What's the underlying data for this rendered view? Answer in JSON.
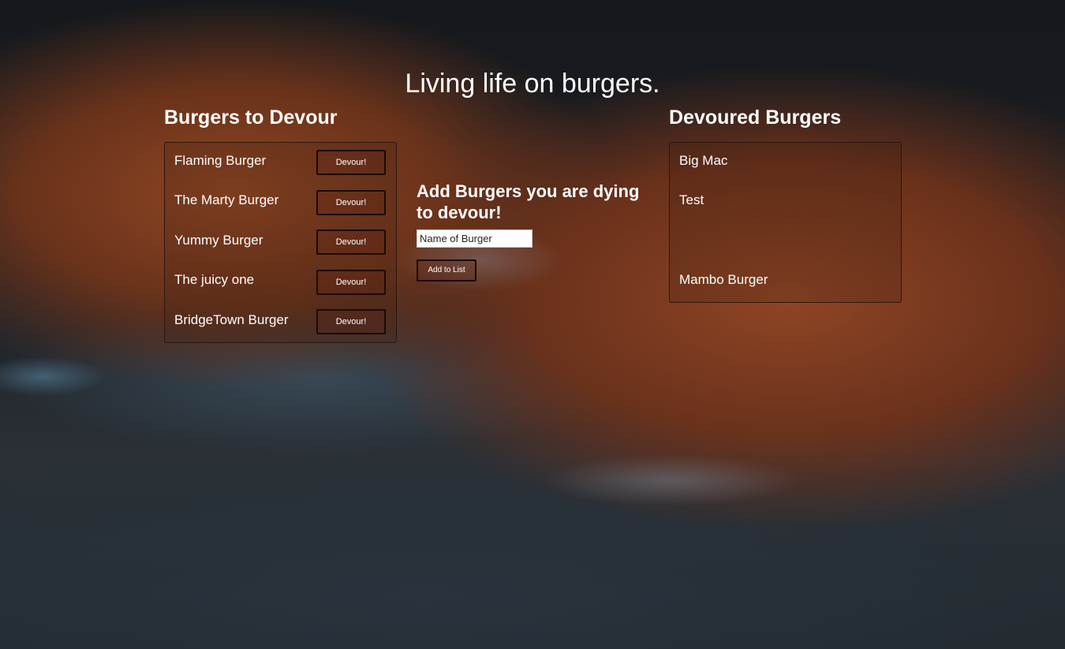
{
  "page": {
    "title": "Living life on burgers."
  },
  "to_devour": {
    "title": "Burgers to Devour",
    "button_label": "Devour!",
    "items": [
      {
        "name": "Flaming Burger"
      },
      {
        "name": "The Marty Burger"
      },
      {
        "name": "Yummy Burger"
      },
      {
        "name": "The juicy one"
      },
      {
        "name": "BridgeTown Burger"
      }
    ]
  },
  "add_form": {
    "title": "Add Burgers you are dying to devour!",
    "input_value": "Name of Burger",
    "input_placeholder": "Name of Burger",
    "button_label": "Add to List"
  },
  "devoured": {
    "title": "Devoured Burgers",
    "items": [
      {
        "name": "Big Mac"
      },
      {
        "name": "Test"
      },
      {
        "name": ""
      },
      {
        "name": "Mambo Burger"
      }
    ]
  },
  "colors": {
    "text": "#ffffff",
    "button_border": "#1a0c08",
    "input_background": "#ffffff"
  }
}
